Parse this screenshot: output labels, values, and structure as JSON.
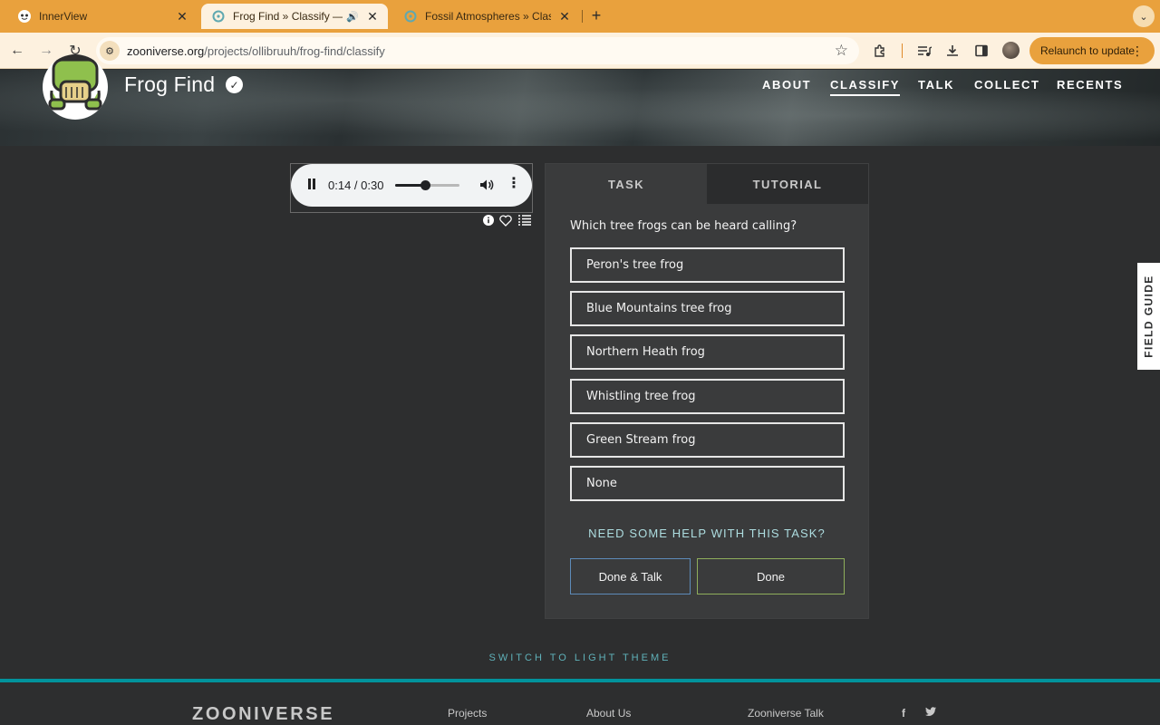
{
  "browser": {
    "tabs": [
      {
        "title": "InnerView",
        "favicon": "innerview-icon"
      },
      {
        "title": "Frog Find » Classify — Zooniverse",
        "favicon": "zooniverse-icon",
        "active": true,
        "playing_audio": true
      },
      {
        "title": "Fossil Atmospheres » Classify",
        "favicon": "zooniverse-icon"
      }
    ],
    "url_host": "zooniverse.org",
    "url_path": "/projects/ollibruuh/frog-find/classify",
    "relaunch_label": "Relaunch to update",
    "accent_color": "#e9a13d"
  },
  "project": {
    "title": "Frog Find",
    "nav": [
      {
        "label": "ABOUT"
      },
      {
        "label": "CLASSIFY",
        "active": true
      },
      {
        "label": "TALK"
      },
      {
        "label": "COLLECT"
      },
      {
        "label": "RECENTS"
      }
    ]
  },
  "player": {
    "time": "0:14 / 0:30",
    "progress": 0.467
  },
  "task": {
    "tabs": [
      {
        "label": "TASK",
        "active": true
      },
      {
        "label": "TUTORIAL"
      }
    ],
    "question": "Which tree frogs can be heard calling?",
    "answers": [
      "Peron's tree frog",
      "Blue Mountains tree frog",
      "Northern Heath frog",
      "Whistling tree frog",
      "Green Stream frog",
      "None"
    ],
    "help_label": "NEED SOME HELP WITH THIS TASK?",
    "done_talk_label": "Done & Talk",
    "done_label": "Done"
  },
  "field_guide_label": "FIELD GUIDE",
  "switch_theme_label": "SWITCH TO LIGHT THEME",
  "footer": {
    "logo_text": "ZOONIVERSE",
    "links": [
      "Projects",
      "About Us",
      "Zooniverse Talk"
    ],
    "social": [
      "facebook-icon",
      "twitter-icon"
    ],
    "accent_color": "#00939c"
  }
}
